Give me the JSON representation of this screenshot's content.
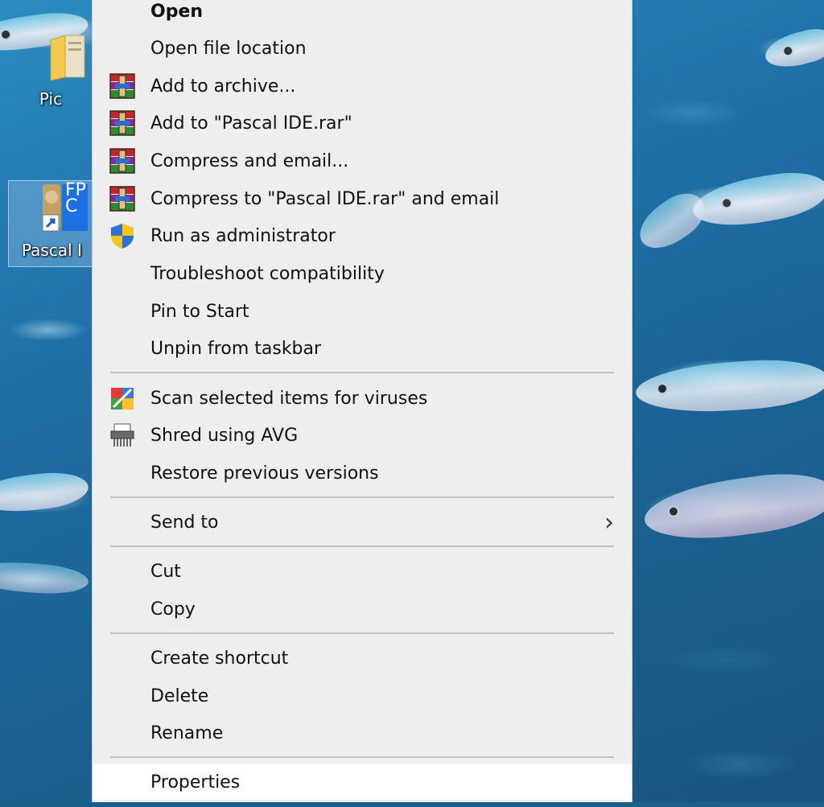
{
  "desktop": {
    "icons": [
      {
        "name": "pictures-folder",
        "label": "Pic"
      },
      {
        "name": "pascal-ide-shortcut",
        "label": "Pascal I"
      }
    ],
    "shortcut_badge_text": "FPC"
  },
  "menu": {
    "items": [
      {
        "label": "Open",
        "icon": "none",
        "bold": true
      },
      {
        "label": "Open file location",
        "icon": "none"
      },
      {
        "label": "Add to archive...",
        "icon": "winrar-icon"
      },
      {
        "label": "Add to \"Pascal IDE.rar\"",
        "icon": "winrar-icon"
      },
      {
        "label": "Compress and email...",
        "icon": "winrar-icon"
      },
      {
        "label": "Compress to \"Pascal IDE.rar\" and email",
        "icon": "winrar-icon"
      },
      {
        "label": "Run as administrator",
        "icon": "uac-shield-icon"
      },
      {
        "label": "Troubleshoot compatibility",
        "icon": "none"
      },
      {
        "label": "Pin to Start",
        "icon": "none"
      },
      {
        "label": "Unpin from taskbar",
        "icon": "none"
      },
      {
        "label": "Scan selected items for viruses",
        "icon": "avg-scan-icon"
      },
      {
        "label": "Shred using AVG",
        "icon": "shredder-icon"
      },
      {
        "label": "Restore previous versions",
        "icon": "none"
      },
      {
        "label": "Send to",
        "icon": "none",
        "submenu": true
      },
      {
        "label": "Cut",
        "icon": "none"
      },
      {
        "label": "Copy",
        "icon": "none"
      },
      {
        "label": "Create shortcut",
        "icon": "none"
      },
      {
        "label": "Delete",
        "icon": "none"
      },
      {
        "label": "Rename",
        "icon": "none"
      },
      {
        "label": "Properties",
        "icon": "none",
        "highlighted": true
      }
    ],
    "submenu_arrow": "›"
  },
  "colors": {
    "menu_background": "#eeeeee",
    "highlight": "#ffffff",
    "separator": "#c0c0c0",
    "text": "#111111"
  }
}
